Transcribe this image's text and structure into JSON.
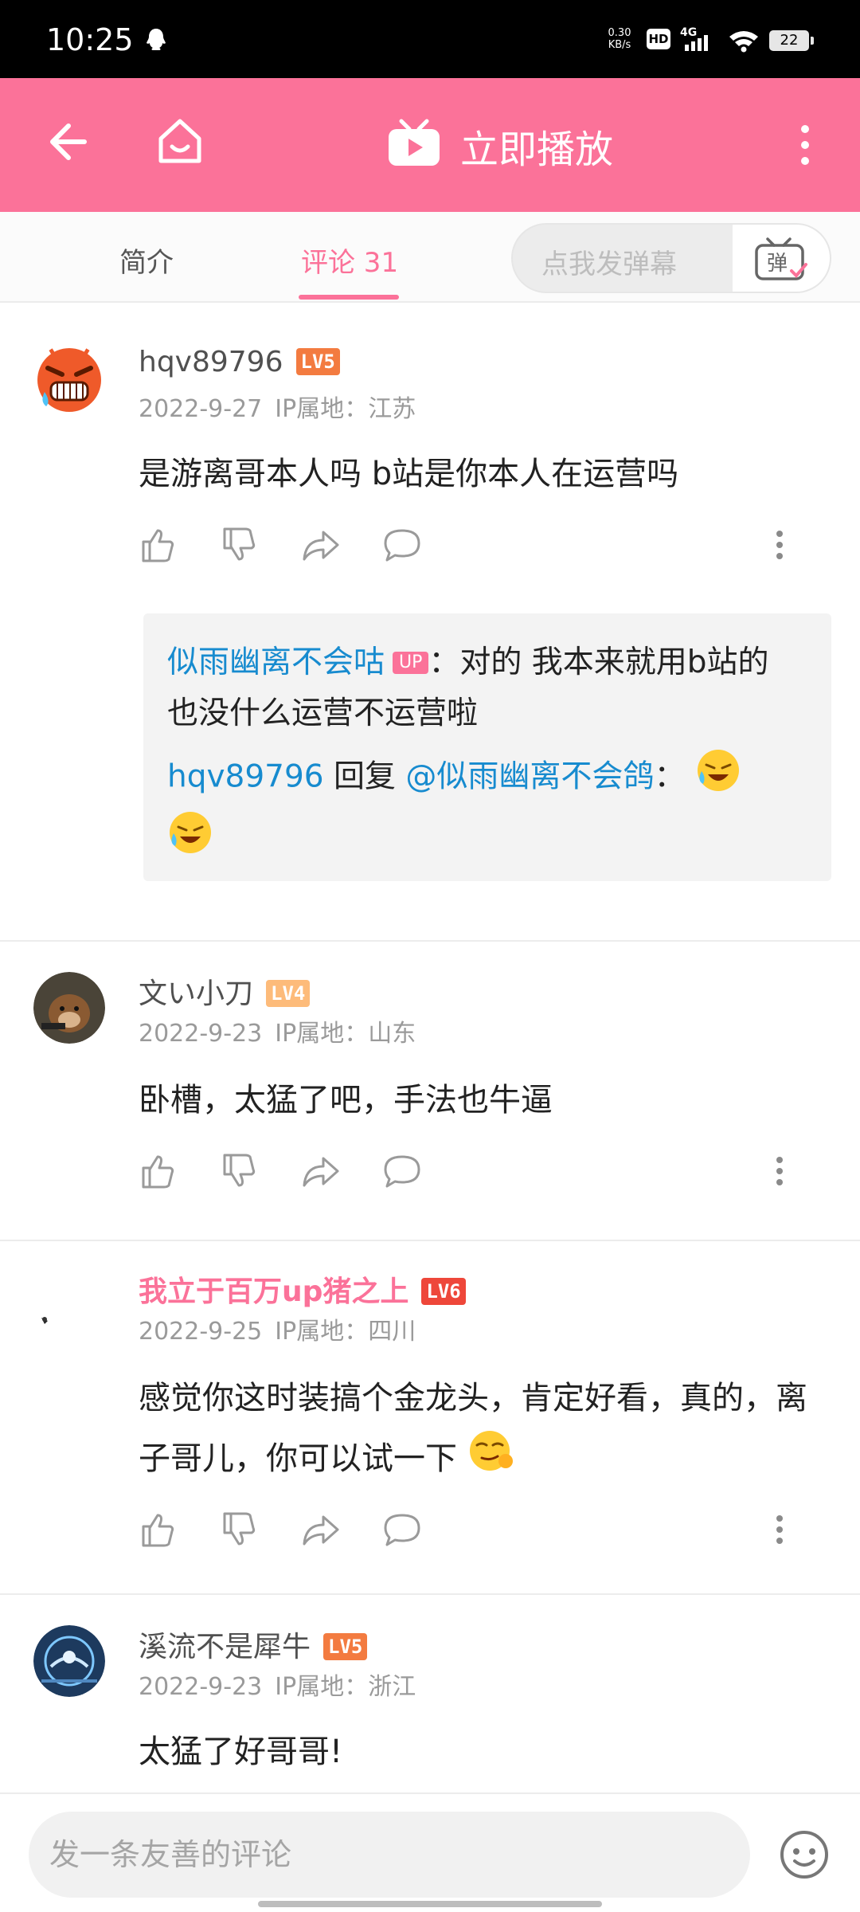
{
  "status_bar": {
    "time": "10:25",
    "net_speed_value": "0.30",
    "net_speed_unit": "KB/s",
    "hd_badge": "HD",
    "network": "4G",
    "battery": "22"
  },
  "top_bar": {
    "play_label": "立即播放",
    "accent_color": "#fb7299"
  },
  "tabs": {
    "intro": "简介",
    "comments": "评论 31",
    "danmaku_placeholder": "点我发弹幕",
    "danmaku_button": "弹"
  },
  "comments": [
    {
      "user": "hqv89796",
      "level": "LV5",
      "level_color": "#f37b40",
      "date": "2022-9-27",
      "ip": "IP属地：江苏",
      "text": "是游离哥本人吗  b站是你本人在运营吗",
      "replies": [
        {
          "user": "似雨幽离不会咕",
          "badge": "UP",
          "text": "：对的 我本来就用b站的 也没什么运营不运营啦"
        },
        {
          "user": "hqv89796",
          "reply_word": " 回复 ",
          "mention": "@似雨幽离不会鸽",
          "text": "："
        }
      ]
    },
    {
      "user": "文い小刀",
      "level": "LV4",
      "level_color": "#fdbb7a",
      "date": "2022-9-23",
      "ip": "IP属地：山东",
      "text": "卧槽，太猛了吧，手法也牛逼"
    },
    {
      "user": "我立于百万up猪之上",
      "level": "LV6",
      "level_color": "#ee473a",
      "date": "2022-9-25",
      "ip": "IP属地：四川",
      "text": "感觉你这时装搞个金龙头，肯定好看，真的，离子哥儿，你可以试一下"
    },
    {
      "user": "溪流不是犀牛",
      "level": "LV5",
      "level_color": "#f37b40",
      "date": "2022-9-23",
      "ip": "IP属地：浙江",
      "text": "太猛了好哥哥!"
    }
  ],
  "bottom_bar": {
    "comment_placeholder": "发一条友善的评论"
  }
}
